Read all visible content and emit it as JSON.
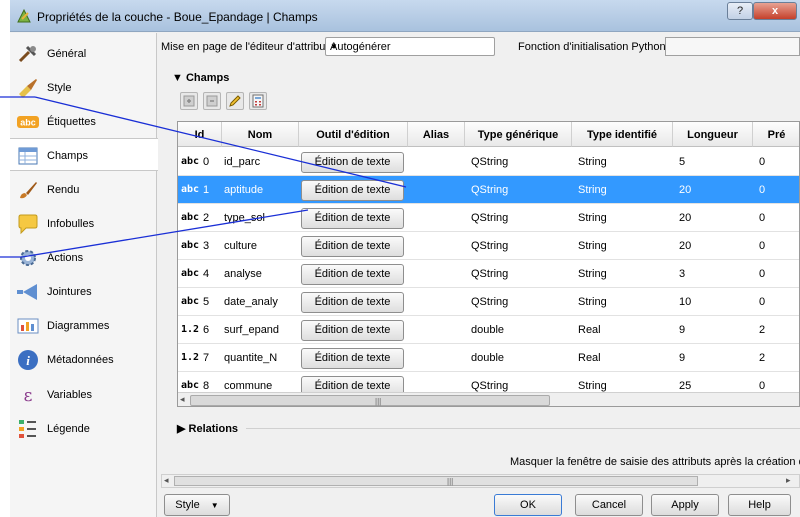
{
  "window": {
    "title": "Propriétés de la couche - Boue_Epandage | Champs",
    "help_label": "?",
    "close_label": "x"
  },
  "sidebar": {
    "items": [
      {
        "label": "Général",
        "icon": "tools-icon"
      },
      {
        "label": "Style",
        "icon": "brush-icon"
      },
      {
        "label": "Étiquettes",
        "icon": "abc-label-icon"
      },
      {
        "label": "Champs",
        "icon": "table-icon",
        "active": true
      },
      {
        "label": "Rendu",
        "icon": "paintbrush-icon"
      },
      {
        "label": "Infobulles",
        "icon": "speech-bubble-icon"
      },
      {
        "label": "Actions",
        "icon": "gear-icon"
      },
      {
        "label": "Jointures",
        "icon": "join-arrow-icon"
      },
      {
        "label": "Diagrammes",
        "icon": "chart-icon"
      },
      {
        "label": "Métadonnées",
        "icon": "info-icon"
      },
      {
        "label": "Variables",
        "icon": "epsilon-icon"
      },
      {
        "label": "Légende",
        "icon": "legend-icon"
      }
    ]
  },
  "top": {
    "layout_label": "Mise en page de l'éditeur d'attribut",
    "layout_value": "Autogénérer",
    "init_label": "Fonction d'initialisation Python"
  },
  "champs": {
    "section_label": "Champs",
    "headers": [
      "Id",
      "Nom",
      "Outil d'édition",
      "Alias",
      "Type générique",
      "Type identifié",
      "Longueur",
      "Pré"
    ],
    "rows": [
      {
        "type": "abc",
        "id": "0",
        "name": "id_parc",
        "tool": "Édition de texte",
        "alias": "",
        "gen": "QString",
        "ident": "String",
        "len": "5",
        "prec": "0"
      },
      {
        "type": "abc",
        "id": "1",
        "name": "aptitude",
        "tool": "Édition de texte",
        "alias": "",
        "gen": "QString",
        "ident": "String",
        "len": "20",
        "prec": "0",
        "selected": true
      },
      {
        "type": "abc",
        "id": "2",
        "name": "type_sol",
        "tool": "Édition de texte",
        "alias": "",
        "gen": "QString",
        "ident": "String",
        "len": "20",
        "prec": "0"
      },
      {
        "type": "abc",
        "id": "3",
        "name": "culture",
        "tool": "Édition de texte",
        "alias": "",
        "gen": "QString",
        "ident": "String",
        "len": "20",
        "prec": "0"
      },
      {
        "type": "abc",
        "id": "4",
        "name": "analyse",
        "tool": "Édition de texte",
        "alias": "",
        "gen": "QString",
        "ident": "String",
        "len": "3",
        "prec": "0"
      },
      {
        "type": "abc",
        "id": "5",
        "name": "date_analy",
        "tool": "Édition de texte",
        "alias": "",
        "gen": "QString",
        "ident": "String",
        "len": "10",
        "prec": "0"
      },
      {
        "type": "1.2",
        "id": "6",
        "name": "surf_epand",
        "tool": "Édition de texte",
        "alias": "",
        "gen": "double",
        "ident": "Real",
        "len": "9",
        "prec": "2"
      },
      {
        "type": "1.2",
        "id": "7",
        "name": "quantite_N",
        "tool": "Édition de texte",
        "alias": "",
        "gen": "double",
        "ident": "Real",
        "len": "9",
        "prec": "2"
      },
      {
        "type": "abc",
        "id": "8",
        "name": "commune",
        "tool": "Édition de texte",
        "alias": "",
        "gen": "QString",
        "ident": "String",
        "len": "25",
        "prec": "0"
      }
    ]
  },
  "relations_label": "Relations",
  "mask_label": "Masquer la fenêtre de saisie des attributs après la création de",
  "buttons": {
    "style": "Style",
    "ok": "OK",
    "cancel": "Cancel",
    "apply": "Apply",
    "help": "Help"
  },
  "colors": {
    "selection": "#3399ff",
    "callout": "#1a2fd6"
  }
}
